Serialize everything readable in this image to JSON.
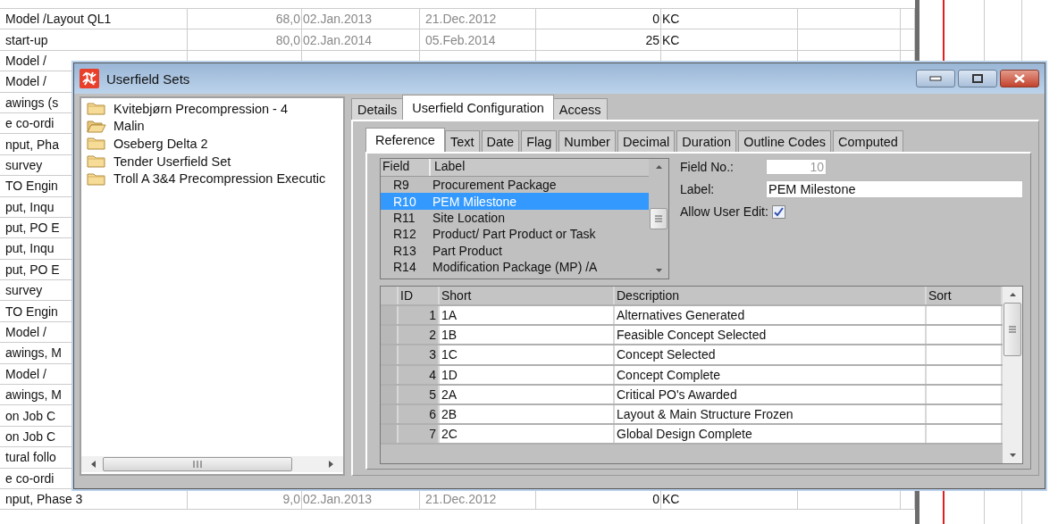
{
  "background_table": {
    "rows": [
      {
        "column_1": "Model /Layout QL1",
        "column_2": "68,0",
        "column_3": "02.Jan.2013",
        "column_4": "21.Dec.2012",
        "column_5": "0",
        "column_6": "KC"
      },
      {
        "column_1": "start-up",
        "column_2": "80,0",
        "column_3": "02.Jan.2014",
        "column_4": "05.Feb.2014",
        "column_5": "25",
        "column_6": "KC"
      },
      {
        "column_1": "Model /"
      },
      {
        "column_1": "Model /"
      },
      {
        "column_1": "awings (s"
      },
      {
        "column_1": "e co-ordi"
      },
      {
        "column_1": "nput, Pha"
      },
      {
        "column_1": "survey"
      },
      {
        "column_1": "TO Engin"
      },
      {
        "column_1": "put, Inqu"
      },
      {
        "column_1": "put, PO E"
      },
      {
        "column_1": "put, Inqu"
      },
      {
        "column_1": "put, PO E"
      },
      {
        "column_1": "survey"
      },
      {
        "column_1": "TO Engin"
      },
      {
        "column_1": "Model /"
      },
      {
        "column_1": "awings, M"
      },
      {
        "column_1": "Model /"
      },
      {
        "column_1": "awings, M"
      },
      {
        "column_1": "on Job C"
      },
      {
        "column_1": "on Job C"
      },
      {
        "column_1": "tural follo"
      },
      {
        "column_1": "e co-ordi"
      },
      {
        "column_1": "nput, Phase 3",
        "column_2": "9,0",
        "column_3": "02.Jan.2013",
        "column_4": "21.Dec.2012",
        "column_5": "0",
        "column_6": "KC"
      }
    ]
  },
  "dialog": {
    "title": "Userfield Sets",
    "sets": [
      {
        "label": "Kvitebjørn Precompression - 4",
        "open": false
      },
      {
        "label": "Malin",
        "open": true
      },
      {
        "label": "Oseberg Delta 2",
        "open": false
      },
      {
        "label": "Tender Userfield Set",
        "open": false
      },
      {
        "label": "Troll A 3&4 Precompression Executic",
        "open": false
      }
    ],
    "tabs": [
      {
        "label": "Details",
        "selected": false
      },
      {
        "label": "Userfield Configuration",
        "selected": true
      },
      {
        "label": "Access",
        "selected": false
      }
    ],
    "field_tabs": [
      {
        "label": "Reference",
        "selected": true
      },
      {
        "label": "Text",
        "selected": false
      },
      {
        "label": "Date",
        "selected": false
      },
      {
        "label": "Flag",
        "selected": false
      },
      {
        "label": "Number",
        "selected": false
      },
      {
        "label": "Decimal",
        "selected": false
      },
      {
        "label": "Duration",
        "selected": false
      },
      {
        "label": "Outline Codes",
        "selected": false
      },
      {
        "label": "Computed",
        "selected": false
      }
    ],
    "field_list": {
      "columns": [
        "Field",
        "Label"
      ],
      "rows": [
        {
          "field": "R9",
          "label": "Procurement Package",
          "selected": false
        },
        {
          "field": "R10",
          "label": "PEM Milestone",
          "selected": true
        },
        {
          "field": "R11",
          "label": "Site Location",
          "selected": false
        },
        {
          "field": "R12",
          "label": "Product/ Part Product or Task",
          "selected": false
        },
        {
          "field": "R13",
          "label": "Part Product",
          "selected": false
        },
        {
          "field": "R14",
          "label": "Modification Package (MP) /A",
          "selected": false
        }
      ]
    },
    "field_no": {
      "label": "Field No.:",
      "value": "10"
    },
    "label_field": {
      "label": "Label:",
      "value": "PEM Milestone"
    },
    "allow_user_edit": {
      "label": "Allow User Edit:",
      "checked": true
    },
    "values_grid": {
      "columns": [
        "ID",
        "Short",
        "Description",
        "Sort"
      ],
      "rows": [
        {
          "id": "1",
          "short": "1A",
          "description": "Alternatives Generated"
        },
        {
          "id": "2",
          "short": "1B",
          "description": "Feasible Concept Selected"
        },
        {
          "id": "3",
          "short": "1C",
          "description": "Concept Selected"
        },
        {
          "id": "4",
          "short": "1D",
          "description": "Concept Complete"
        },
        {
          "id": "5",
          "short": "2A",
          "description": "Critical PO's Awarded"
        },
        {
          "id": "6",
          "short": "2B",
          "description": "Layout & Main Structure Frozen"
        },
        {
          "id": "7",
          "short": "2C",
          "description": "Global Design Complete"
        }
      ]
    }
  }
}
